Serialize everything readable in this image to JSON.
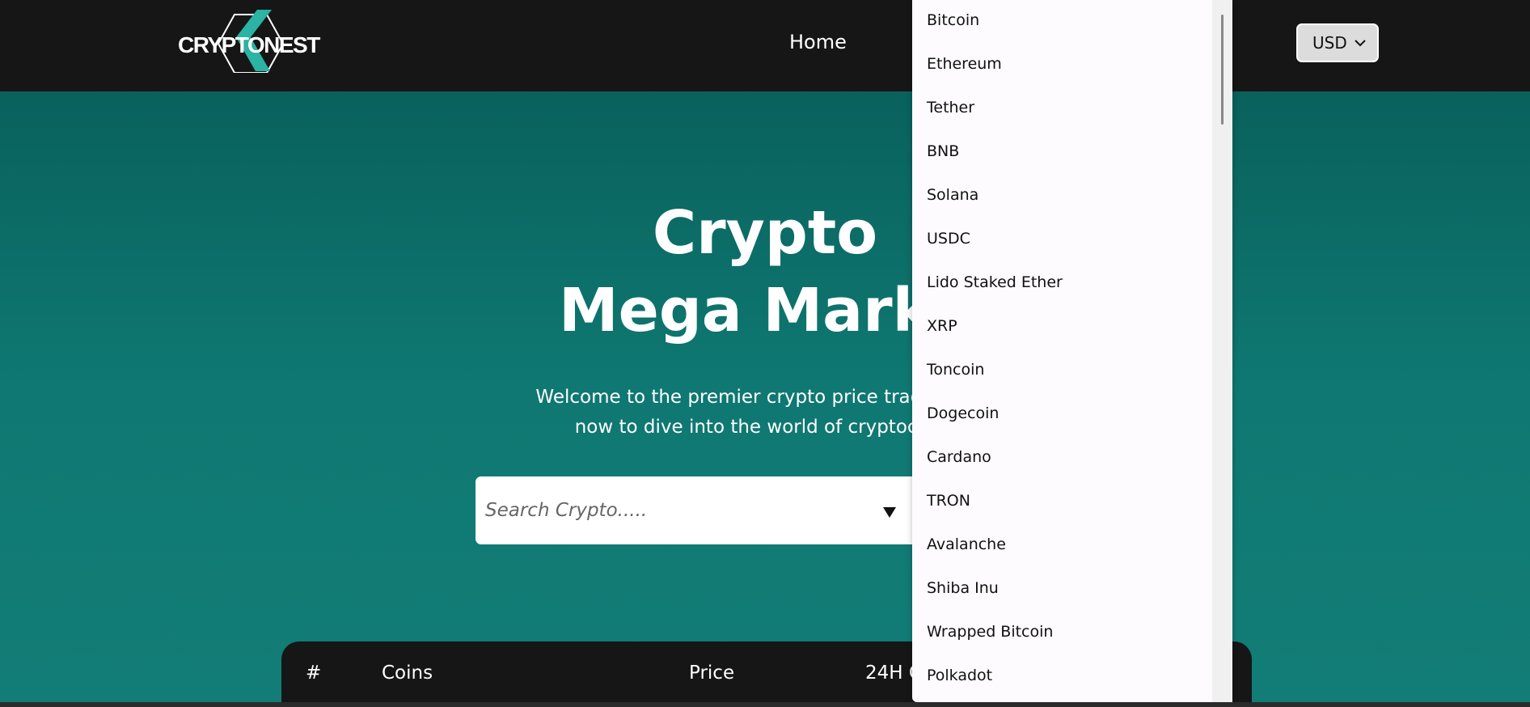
{
  "navbar": {
    "logo_text": "CRYPTONEST",
    "home_label": "Home",
    "currency": "USD"
  },
  "hero": {
    "title_line1": "Crypto",
    "title_line2": "Mega Marke",
    "subtitle_line1": "Welcome to the premier crypto price tracking pla",
    "subtitle_line2": "now to dive into the world of cryptocurre"
  },
  "search": {
    "placeholder": "Search Crypto....."
  },
  "table": {
    "headers": [
      "#",
      "Coins",
      "Price",
      "24H C"
    ]
  },
  "dropdown": {
    "items": [
      "Bitcoin",
      "Ethereum",
      "Tether",
      "BNB",
      "Solana",
      "USDC",
      "Lido Staked Ether",
      "XRP",
      "Toncoin",
      "Dogecoin",
      "Cardano",
      "TRON",
      "Avalanche",
      "Shiba Inu",
      "Wrapped Bitcoin",
      "Polkadot"
    ]
  },
  "colors": {
    "navbar_bg": "#161616",
    "hero_top": "#075a55",
    "hero_bottom": "#127d76",
    "accent": "#2bb3a3"
  }
}
